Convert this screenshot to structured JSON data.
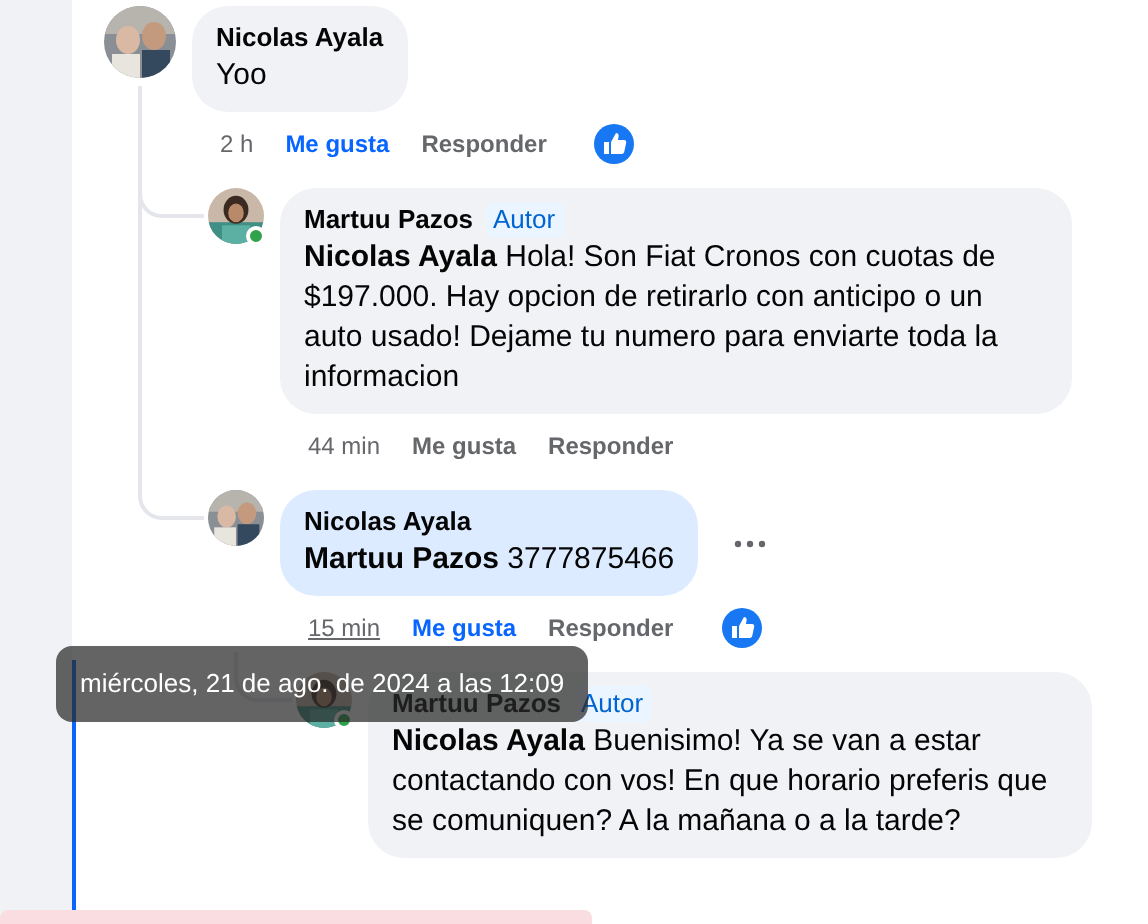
{
  "comments": [
    {
      "author": "Nicolas Ayala",
      "text": "Yoo",
      "time": "2 h",
      "like_label": "Me gusta",
      "reply_label": "Responder",
      "liked": true,
      "has_reaction": true,
      "time_hovered": false,
      "children": [
        {
          "author": "Martuu Pazos",
          "badge": "Autor",
          "text": "**Nicolas Ayala** Hola! Son Fiat Cronos con cuotas de $197.000. Hay opcion de retirarlo con anticipo o un auto usado! Dejame tu numero para enviarte toda la informacion",
          "time": "44 min",
          "like_label": "Me gusta",
          "reply_label": "Responder",
          "liked": false,
          "online": true,
          "time_hovered": false
        },
        {
          "author": "Nicolas Ayala",
          "text": "**Martuu Pazos** 3777875466",
          "time": "15 min",
          "like_label": "Me gusta",
          "reply_label": "Responder",
          "liked": true,
          "has_reaction": true,
          "highlighted": true,
          "time_hovered": true,
          "menu_button": true,
          "children": [
            {
              "author": "Martuu Pazos",
              "badge": "Autor",
              "text": "**Nicolas Ayala** Buenisimo! Ya se van a estar contactando con vos! En que horario preferis que se comuniquen? A la mañana o a la tarde?",
              "online": true
            }
          ]
        }
      ]
    }
  ],
  "tooltip": {
    "text": "miércoles, 21 de ago. de 2024 a las 12:09"
  }
}
